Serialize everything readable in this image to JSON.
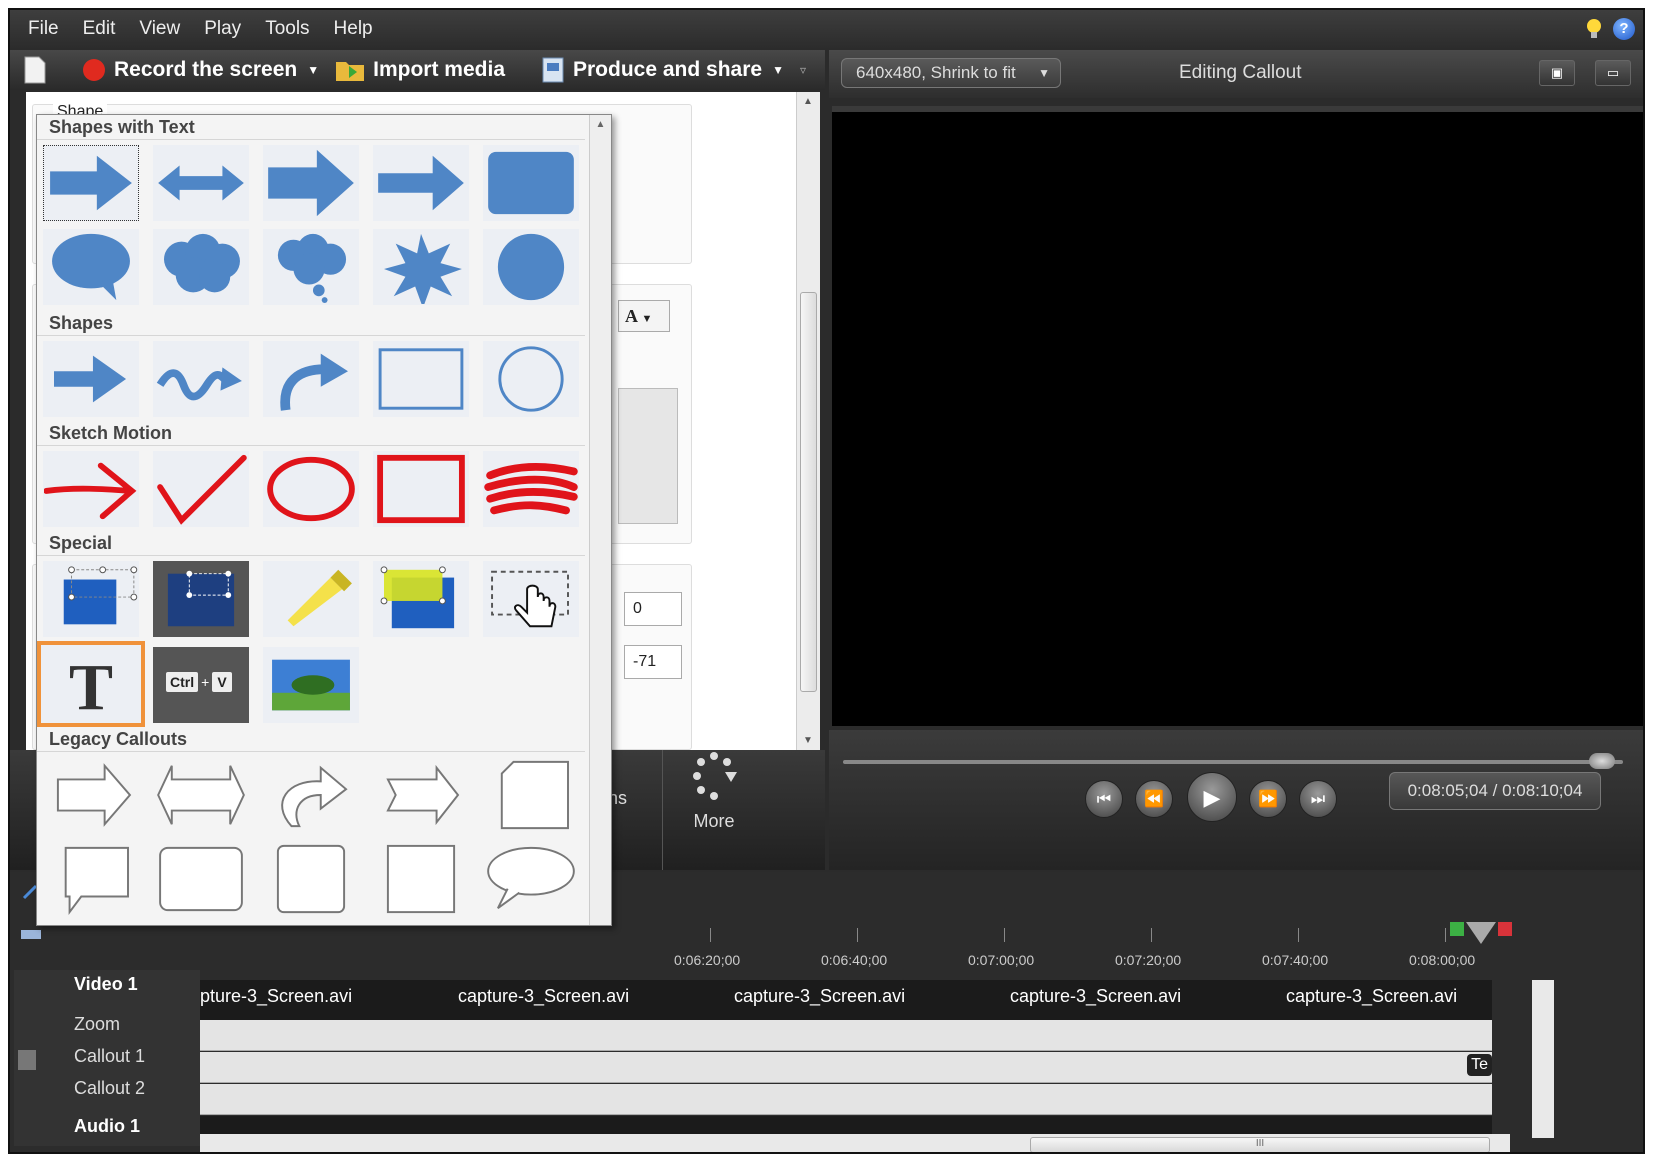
{
  "menu": [
    "File",
    "Edit",
    "View",
    "Play",
    "Tools",
    "Help"
  ],
  "toolbar": {
    "record_label": "Record the screen",
    "import_label": "Import media",
    "produce_label": "Produce and share"
  },
  "properties": {
    "shape_group_label": "Shape",
    "field_x": "0",
    "field_y": "-71",
    "partial_tab_text": "ns",
    "more_label": "More"
  },
  "gallery": {
    "sections": [
      "Shapes with Text",
      "Shapes",
      "Sketch Motion",
      "Special",
      "Legacy Callouts"
    ],
    "hotkey_text": {
      "ctrl": "Ctrl",
      "plus": "+",
      "v": "V"
    }
  },
  "preview": {
    "size_combo": "640x480, Shrink to fit",
    "title": "Editing Callout",
    "time": "0:08:05;04 / 0:08:10;04"
  },
  "timeline": {
    "ruler_labels": [
      "0:06:20;00",
      "0:06:40;00",
      "0:07:00;00",
      "0:07:20;00",
      "0:07:40;00",
      "0:08:00;00"
    ],
    "tracks": [
      "Video 1",
      "Zoom",
      "Callout 1",
      "Callout 2",
      "Audio 1"
    ],
    "clips": [
      "pture-3_Screen.avi",
      "capture-3_Screen.avi",
      "capture-3_Screen.avi",
      "capture-3_Screen.avi",
      "capture-3_Screen.avi"
    ],
    "callout_clip": "Te",
    "hscroll_grip": "III"
  },
  "colors": {
    "accent_orange": "#f0923a",
    "shape_blue": "#4f86c6",
    "sketch_red": "#e0141a"
  }
}
